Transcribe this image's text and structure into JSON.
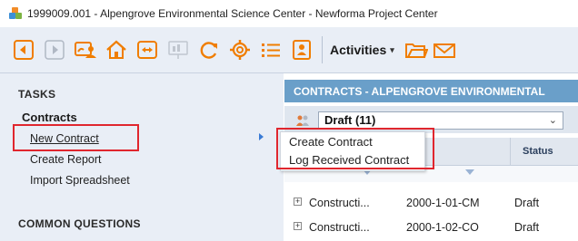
{
  "window": {
    "title": "1999009.001 - Alpengrove Environmental Science Center - Newforma Project Center"
  },
  "toolbar": {
    "buttons": [
      {
        "icon": "back-arrow-icon"
      },
      {
        "icon": "forward-arrow-icon"
      },
      {
        "icon": "team-icon"
      },
      {
        "icon": "home-icon"
      },
      {
        "icon": "transfer-icon"
      },
      {
        "icon": "presentation-icon"
      },
      {
        "icon": "refresh-icon"
      },
      {
        "icon": "settings-icon"
      },
      {
        "icon": "list-icon"
      },
      {
        "icon": "contacts-icon"
      }
    ],
    "activities_label": "Activities",
    "activities_caret": "▾",
    "accent_color": "#f07d00"
  },
  "sidebar": {
    "tasks_heading": "TASKS",
    "contracts_heading": "Contracts",
    "links": [
      "New Contract",
      "Create Report",
      "Import Spreadsheet"
    ],
    "common_questions_heading": "COMMON QUESTIONS"
  },
  "panel": {
    "header": "CONTRACTS - ALPENGROVE ENVIRONMENTAL",
    "filter_value": "Draft (11)",
    "status_column": "Status",
    "rows": [
      {
        "name": "Constructi...",
        "number": "2000-1-01-CM",
        "status": "Draft"
      },
      {
        "name": "Constructi...",
        "number": "2000-1-02-CO",
        "status": "Draft"
      }
    ]
  },
  "popup_menu": {
    "items": [
      "Create Contract",
      "Log Received Contract"
    ]
  },
  "highlight_color": "#e0262e"
}
